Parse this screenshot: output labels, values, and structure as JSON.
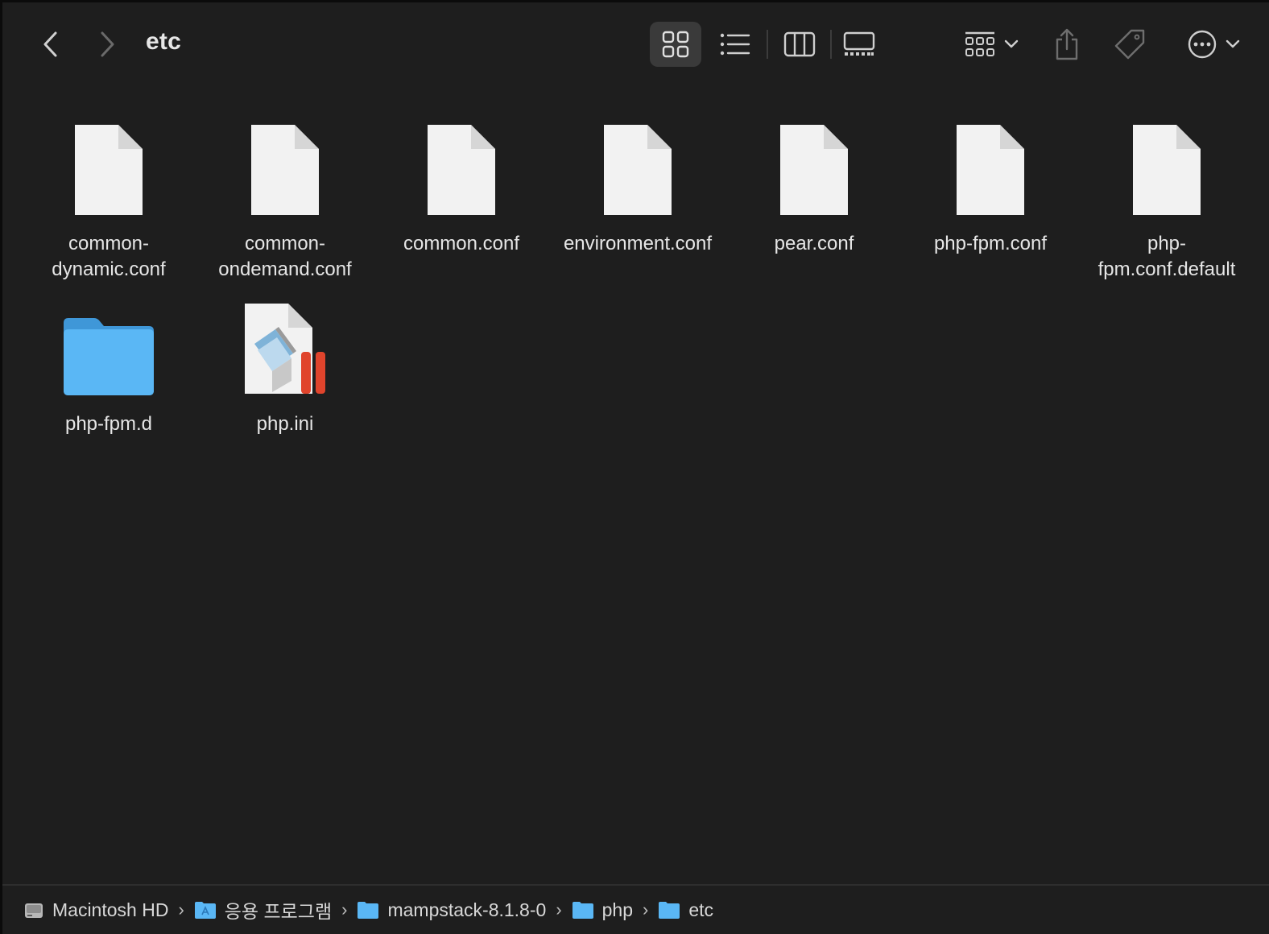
{
  "window": {
    "title": "etc"
  },
  "toolbar": {
    "back_icon": "chevron-left-icon",
    "forward_icon": "chevron-right-icon",
    "views": [
      "icon-view",
      "list-view",
      "column-view",
      "gallery-view"
    ],
    "selected_view": "icon-view"
  },
  "files": [
    {
      "name": "common-\ndynamic.conf",
      "kind": "document"
    },
    {
      "name": "common-\nondemand.conf",
      "kind": "document"
    },
    {
      "name": "common.conf",
      "kind": "document"
    },
    {
      "name": "environment.conf",
      "kind": "document"
    },
    {
      "name": "pear.conf",
      "kind": "document"
    },
    {
      "name": "php-fpm.conf",
      "kind": "document"
    },
    {
      "name": "php-\nfpm.conf.default",
      "kind": "document"
    },
    {
      "name": "php-fpm.d",
      "kind": "folder"
    },
    {
      "name": "php.ini",
      "kind": "textedit-document"
    }
  ],
  "pathbar": [
    {
      "label": "Macintosh HD",
      "icon": "hard-drive-icon"
    },
    {
      "label": "응용 프로그램",
      "icon": "applications-folder-icon"
    },
    {
      "label": "mampstack-8.1.8-0",
      "icon": "folder-icon"
    },
    {
      "label": "php",
      "icon": "folder-icon"
    },
    {
      "label": "etc",
      "icon": "folder-icon"
    }
  ],
  "colors": {
    "background": "#1e1e1e",
    "folder": "#5ab7f5",
    "document": "#f2f2f2",
    "accent_red": "#e0442c"
  }
}
